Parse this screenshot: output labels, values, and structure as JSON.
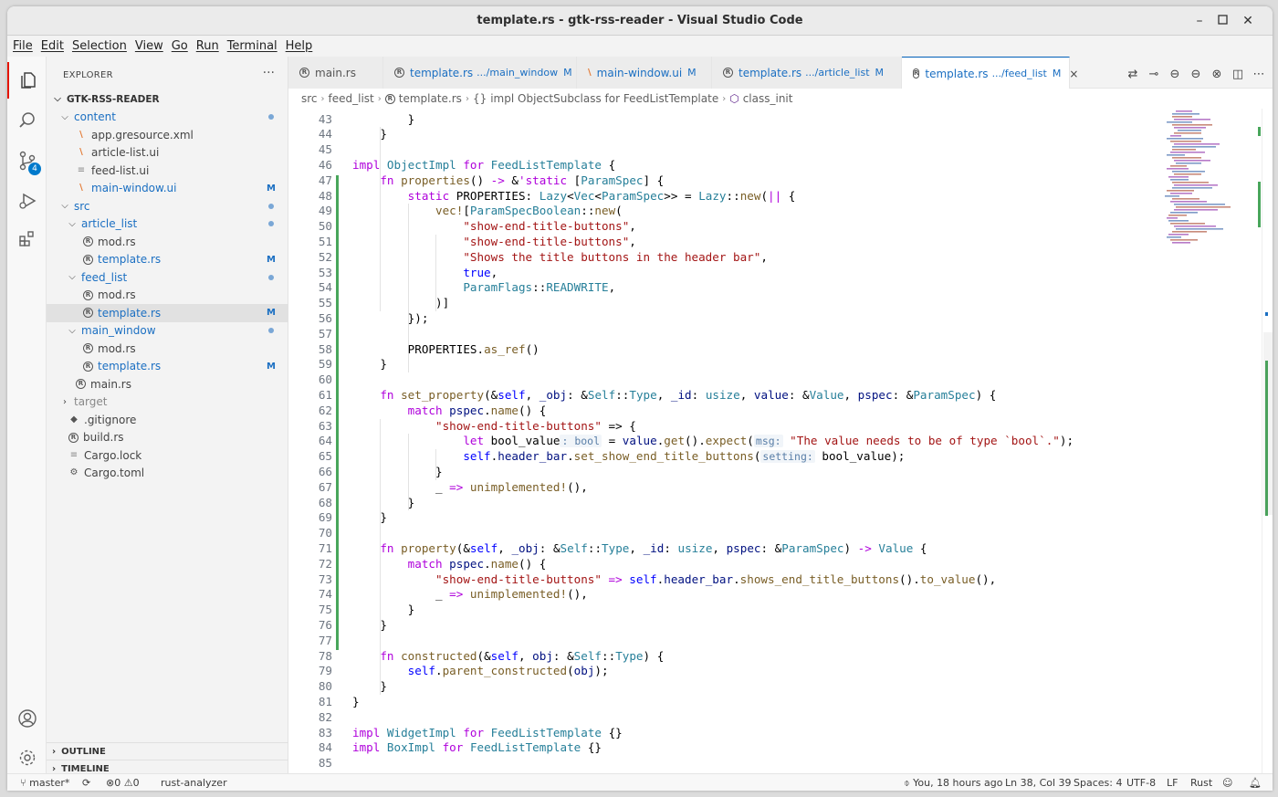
{
  "window": {
    "title": "template.rs - gtk-rss-reader - Visual Studio Code"
  },
  "menu": [
    "File",
    "Edit",
    "Selection",
    "View",
    "Go",
    "Run",
    "Terminal",
    "Help"
  ],
  "activity": {
    "scm_badge": "4"
  },
  "explorer": {
    "header": "EXPLORER",
    "more": "···",
    "project": "GTK-RSS-READER",
    "items": [
      {
        "label": "content",
        "kind": "folder",
        "open": true
      },
      {
        "label": "app.gresource.xml",
        "kind": "rss"
      },
      {
        "label": "article-list.ui",
        "kind": "rss"
      },
      {
        "label": "feed-list.ui",
        "kind": "plain"
      },
      {
        "label": "main-window.ui",
        "kind": "rss",
        "status": "M"
      },
      {
        "label": "src",
        "kind": "folder",
        "open": true
      },
      {
        "label": "article_list",
        "kind": "folder",
        "open": true
      },
      {
        "label": "mod.rs",
        "kind": "rs"
      },
      {
        "label": "template.rs",
        "kind": "rs",
        "status": "M"
      },
      {
        "label": "feed_list",
        "kind": "folder",
        "open": true
      },
      {
        "label": "mod.rs",
        "kind": "rs"
      },
      {
        "label": "template.rs",
        "kind": "rs",
        "status": "M",
        "selected": true
      },
      {
        "label": "main_window",
        "kind": "folder",
        "open": true
      },
      {
        "label": "mod.rs",
        "kind": "rs"
      },
      {
        "label": "template.rs",
        "kind": "rs",
        "status": "M"
      },
      {
        "label": "main.rs",
        "kind": "rs"
      },
      {
        "label": "target",
        "kind": "folder",
        "open": false
      },
      {
        "label": ".gitignore",
        "kind": "git"
      },
      {
        "label": "build.rs",
        "kind": "rs"
      },
      {
        "label": "Cargo.lock",
        "kind": "plain"
      },
      {
        "label": "Cargo.toml",
        "kind": "gear"
      }
    ],
    "outline": "OUTLINE",
    "timeline": "TIMELINE"
  },
  "tabs": [
    {
      "name": "main.rs",
      "path": "",
      "status": ""
    },
    {
      "name": "template.rs",
      "path": ".../main_window",
      "status": "M"
    },
    {
      "name": "main-window.ui",
      "path": "",
      "status": "M"
    },
    {
      "name": "template.rs",
      "path": ".../article_list",
      "status": "M"
    },
    {
      "name": "template.rs",
      "path": ".../feed_list",
      "status": "M",
      "close": "×"
    }
  ],
  "breadcrumb": [
    "src",
    "feed_list",
    "template.rs",
    "impl ObjectSubclass for FeedListTemplate",
    "class_init"
  ],
  "code": {
    "first_line": 43,
    "lines": [
      [
        [
          "op",
          "        }"
        ]
      ],
      [
        [
          "op",
          "    }"
        ]
      ],
      [],
      [
        [
          "kw",
          "impl "
        ],
        [
          "ty",
          "ObjectImpl "
        ],
        [
          "kw",
          "for "
        ],
        [
          "ty",
          "FeedListTemplate "
        ],
        [
          "op",
          "{"
        ]
      ],
      [
        [
          "kw",
          "    fn "
        ],
        [
          "fn",
          "properties"
        ],
        [
          "op",
          "() "
        ],
        [
          "kw",
          "-> "
        ],
        [
          "op",
          "&"
        ],
        [
          "kw",
          "'static "
        ],
        [
          "op",
          "["
        ],
        [
          "ty",
          "ParamSpec"
        ],
        [
          "op",
          "] {"
        ]
      ],
      [
        [
          "kw",
          "        static "
        ],
        [
          "op",
          "PROPERTIES: "
        ],
        [
          "ty",
          "Lazy"
        ],
        [
          "op",
          "<"
        ],
        [
          "ty",
          "Vec"
        ],
        [
          "op",
          "<"
        ],
        [
          "ty",
          "ParamSpec"
        ],
        [
          "op",
          ">> = "
        ],
        [
          "ty",
          "Lazy"
        ],
        [
          "op",
          "::"
        ],
        [
          "fn",
          "new"
        ],
        [
          "op",
          "("
        ],
        [
          "kw",
          "||"
        ],
        [
          "op",
          " {"
        ]
      ],
      [
        [
          "mc",
          "            vec!"
        ],
        [
          "op",
          "["
        ],
        [
          "ty",
          "ParamSpecBoolean"
        ],
        [
          "op",
          "::"
        ],
        [
          "fn",
          "new"
        ],
        [
          "op",
          "("
        ]
      ],
      [
        [
          "st",
          "                \"show-end-title-buttons\""
        ],
        [
          "op",
          ","
        ]
      ],
      [
        [
          "st",
          "                \"show-end-title-buttons\""
        ],
        [
          "op",
          ","
        ]
      ],
      [
        [
          "st",
          "                \"Shows the title buttons in the header bar\""
        ],
        [
          "op",
          ","
        ]
      ],
      [
        [
          "kb",
          "                true"
        ],
        [
          "op",
          ","
        ]
      ],
      [
        [
          "ty",
          "                ParamFlags"
        ],
        [
          "op",
          "::"
        ],
        [
          "ty",
          "READWRITE"
        ],
        [
          "op",
          ","
        ]
      ],
      [
        [
          "op",
          "            )]"
        ]
      ],
      [
        [
          "op",
          "        });"
        ]
      ],
      [],
      [
        [
          "op",
          "        PROPERTIES."
        ],
        [
          "fn",
          "as_ref"
        ],
        [
          "op",
          "()"
        ]
      ],
      [
        [
          "op",
          "    }"
        ]
      ],
      [],
      [
        [
          "kw",
          "    fn "
        ],
        [
          "fn",
          "set_property"
        ],
        [
          "op",
          "(&"
        ],
        [
          "sf",
          "self"
        ],
        [
          "op",
          ", "
        ],
        [
          "va",
          "_obj"
        ],
        [
          "op",
          ": &"
        ],
        [
          "ty",
          "Self"
        ],
        [
          "op",
          "::"
        ],
        [
          "ty",
          "Type"
        ],
        [
          "op",
          ", "
        ],
        [
          "va",
          "_id"
        ],
        [
          "op",
          ": "
        ],
        [
          "ty",
          "usize"
        ],
        [
          "op",
          ", "
        ],
        [
          "va",
          "value"
        ],
        [
          "op",
          ": &"
        ],
        [
          "ty",
          "Value"
        ],
        [
          "op",
          ", "
        ],
        [
          "va",
          "pspec"
        ],
        [
          "op",
          ": &"
        ],
        [
          "ty",
          "ParamSpec"
        ],
        [
          "op",
          ") {"
        ]
      ],
      [
        [
          "kw",
          "        match "
        ],
        [
          "va",
          "pspec"
        ],
        [
          "op",
          "."
        ],
        [
          "fn",
          "name"
        ],
        [
          "op",
          "() {"
        ]
      ],
      [
        [
          "st",
          "            \"show-end-title-buttons\" "
        ],
        [
          "op",
          "=> {"
        ]
      ],
      [
        [
          "kw",
          "                let "
        ],
        [
          "op",
          "bool_value"
        ],
        [
          "hint",
          ": bool"
        ],
        [
          "op",
          " = "
        ],
        [
          "va",
          "value"
        ],
        [
          "op",
          "."
        ],
        [
          "fn",
          "get"
        ],
        [
          "op",
          "()."
        ],
        [
          "fn",
          "expect"
        ],
        [
          "op",
          "("
        ],
        [
          "hint",
          "msg:"
        ],
        [
          "st",
          " \"The value needs to be of type `bool`.\""
        ],
        [
          "op",
          ");"
        ]
      ],
      [
        [
          "sf",
          "                self"
        ],
        [
          "op",
          "."
        ],
        [
          "va",
          "header_bar"
        ],
        [
          "op",
          "."
        ],
        [
          "fn",
          "set_show_end_title_buttons"
        ],
        [
          "op",
          "("
        ],
        [
          "hint",
          "setting:"
        ],
        [
          "op",
          " bool_value);"
        ]
      ],
      [
        [
          "op",
          "            }"
        ]
      ],
      [
        [
          "op",
          "            _ "
        ],
        [
          "kw",
          "=> "
        ],
        [
          "mc",
          "unimplemented!"
        ],
        [
          "op",
          "(),"
        ]
      ],
      [
        [
          "op",
          "        }"
        ]
      ],
      [
        [
          "op",
          "    }"
        ]
      ],
      [],
      [
        [
          "kw",
          "    fn "
        ],
        [
          "fn",
          "property"
        ],
        [
          "op",
          "(&"
        ],
        [
          "sf",
          "self"
        ],
        [
          "op",
          ", "
        ],
        [
          "va",
          "_obj"
        ],
        [
          "op",
          ": &"
        ],
        [
          "ty",
          "Self"
        ],
        [
          "op",
          "::"
        ],
        [
          "ty",
          "Type"
        ],
        [
          "op",
          ", "
        ],
        [
          "va",
          "_id"
        ],
        [
          "op",
          ": "
        ],
        [
          "ty",
          "usize"
        ],
        [
          "op",
          ", "
        ],
        [
          "va",
          "pspec"
        ],
        [
          "op",
          ": &"
        ],
        [
          "ty",
          "ParamSpec"
        ],
        [
          "op",
          ") "
        ],
        [
          "kw",
          "-> "
        ],
        [
          "ty",
          "Value "
        ],
        [
          "op",
          "{"
        ]
      ],
      [
        [
          "kw",
          "        match "
        ],
        [
          "va",
          "pspec"
        ],
        [
          "op",
          "."
        ],
        [
          "fn",
          "name"
        ],
        [
          "op",
          "() {"
        ]
      ],
      [
        [
          "st",
          "            \"show-end-title-buttons\" "
        ],
        [
          "kw",
          "=> "
        ],
        [
          "sf",
          "self"
        ],
        [
          "op",
          "."
        ],
        [
          "va",
          "header_bar"
        ],
        [
          "op",
          "."
        ],
        [
          "fn",
          "shows_end_title_buttons"
        ],
        [
          "op",
          "()."
        ],
        [
          "fn",
          "to_value"
        ],
        [
          "op",
          "(),"
        ]
      ],
      [
        [
          "op",
          "            _ "
        ],
        [
          "kw",
          "=> "
        ],
        [
          "mc",
          "unimplemented!"
        ],
        [
          "op",
          "(),"
        ]
      ],
      [
        [
          "op",
          "        }"
        ]
      ],
      [
        [
          "op",
          "    }"
        ]
      ],
      [],
      [
        [
          "kw",
          "    fn "
        ],
        [
          "fn",
          "constructed"
        ],
        [
          "op",
          "(&"
        ],
        [
          "sf",
          "self"
        ],
        [
          "op",
          ", "
        ],
        [
          "va",
          "obj"
        ],
        [
          "op",
          ": &"
        ],
        [
          "ty",
          "Self"
        ],
        [
          "op",
          "::"
        ],
        [
          "ty",
          "Type"
        ],
        [
          "op",
          ") {"
        ]
      ],
      [
        [
          "sf",
          "        self"
        ],
        [
          "op",
          "."
        ],
        [
          "fn",
          "parent_constructed"
        ],
        [
          "op",
          "("
        ],
        [
          "va",
          "obj"
        ],
        [
          "op",
          ");"
        ]
      ],
      [
        [
          "op",
          "    }"
        ]
      ],
      [
        [
          "op",
          "}"
        ]
      ],
      [],
      [
        [
          "kw",
          "impl "
        ],
        [
          "ty",
          "WidgetImpl "
        ],
        [
          "kw",
          "for "
        ],
        [
          "ty",
          "FeedListTemplate "
        ],
        [
          "op",
          "{}"
        ]
      ],
      [
        [
          "kw",
          "impl "
        ],
        [
          "ty",
          "BoxImpl "
        ],
        [
          "kw",
          "for "
        ],
        [
          "ty",
          "FeedListTemplate "
        ],
        [
          "op",
          "{}"
        ]
      ],
      []
    ]
  },
  "status": {
    "branch": "master*",
    "errors": "0",
    "warnings": "0",
    "lsp": "rust-analyzer",
    "blame": "You, 18 hours ago",
    "cursor": "Ln 38, Col 39",
    "spaces": "Spaces: 4",
    "encoding": "UTF-8",
    "eol": "LF",
    "language": "Rust"
  },
  "colors": {
    "accent": "#005fb8",
    "modified": "#1b6fc2",
    "git_added": "#48a65b"
  }
}
